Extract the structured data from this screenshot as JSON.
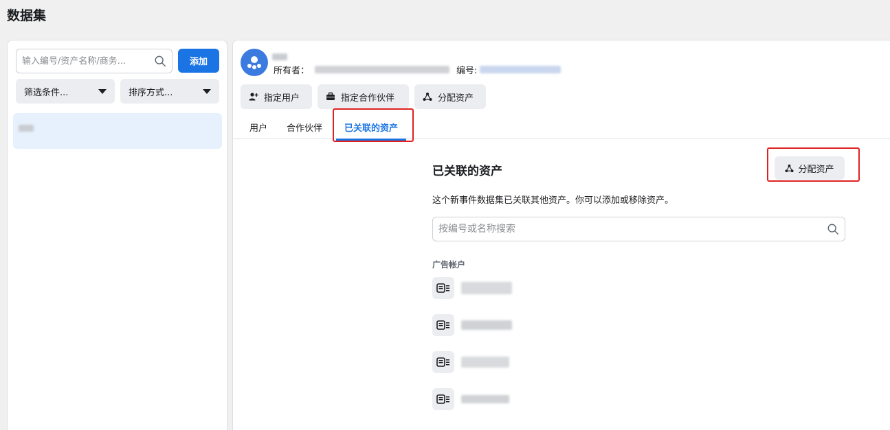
{
  "page": {
    "title": "数据集"
  },
  "sidebar": {
    "search_placeholder": "输入编号/资产名称/商务...",
    "add_label": "添加",
    "filter_label": "筛选条件...",
    "sort_label": "排序方式..."
  },
  "detail": {
    "owner_label": "所有者：",
    "id_label": "编号:",
    "actions": {
      "assign_user": "指定用户",
      "assign_partner": "指定合作伙伴",
      "assign_assets": "分配资产"
    },
    "tabs": {
      "users": "用户",
      "partners": "合作伙伴",
      "linked_assets": "已关联的资产"
    }
  },
  "linked_assets": {
    "title": "已关联的资产",
    "assign_button": "分配资产",
    "description": "这个新事件数据集已关联其他资产。你可以添加或移除资产。",
    "search_placeholder": "按编号或名称搜索",
    "group_label": "广告帐户"
  },
  "colors": {
    "accent": "#1b74e4",
    "highlight_box": "#e02020",
    "selected_item_bg": "#e7f0fd"
  }
}
